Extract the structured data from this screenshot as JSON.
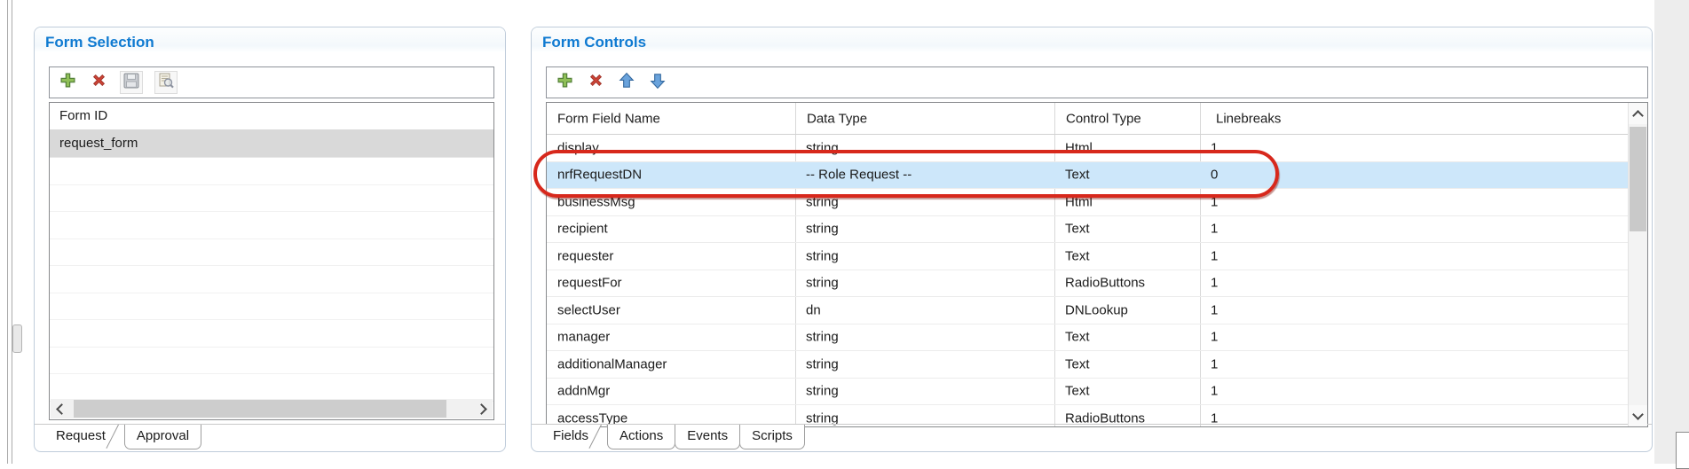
{
  "colors": {
    "title_blue": "#0f7ad1",
    "selected_row_blue": "#cde7fa",
    "selected_item_gray": "#d9d9d9",
    "annotation_red": "#d7281c",
    "toolbar_add_green": "#7ab648",
    "toolbar_delete_red": "#cc4437",
    "toolbar_arrow_blue": "#6aa3dc"
  },
  "left_panel": {
    "title": "Form Selection",
    "toolbar": [
      {
        "icon": "add-plus-icon",
        "enabled": true
      },
      {
        "icon": "delete-x-icon",
        "enabled": true
      },
      {
        "icon": "save-floppy-icon",
        "enabled": false
      },
      {
        "icon": "preview-magnifier-icon",
        "enabled": false
      }
    ],
    "list": {
      "header": "Form ID",
      "items": [
        {
          "label": "request_form",
          "selected": true
        }
      ]
    },
    "tabs": [
      {
        "label": "Request",
        "selected": true
      },
      {
        "label": "Approval",
        "selected": false
      }
    ]
  },
  "right_panel": {
    "title": "Form Controls",
    "toolbar": [
      {
        "icon": "add-plus-icon",
        "enabled": true
      },
      {
        "icon": "delete-x-icon",
        "enabled": true
      },
      {
        "icon": "move-up-arrow-icon",
        "enabled": true
      },
      {
        "icon": "move-down-arrow-icon",
        "enabled": true
      }
    ],
    "table": {
      "columns": [
        "Form Field Name",
        "Data Type",
        "Control Type",
        "Linebreaks"
      ],
      "rows": [
        {
          "cells": [
            "display",
            "string",
            "Html",
            "1"
          ],
          "selected": false
        },
        {
          "cells": [
            "nrfRequestDN",
            "-- Role Request --",
            "Text",
            "0"
          ],
          "selected": true,
          "annotated": true
        },
        {
          "cells": [
            "businessMsg",
            "string",
            "Html",
            "1"
          ],
          "selected": false
        },
        {
          "cells": [
            "recipient",
            "string",
            "Text",
            "1"
          ],
          "selected": false
        },
        {
          "cells": [
            "requester",
            "string",
            "Text",
            "1"
          ],
          "selected": false
        },
        {
          "cells": [
            "requestFor",
            "string",
            "RadioButtons",
            "1"
          ],
          "selected": false
        },
        {
          "cells": [
            "selectUser",
            "dn",
            "DNLookup",
            "1"
          ],
          "selected": false
        },
        {
          "cells": [
            "manager",
            "string",
            "Text",
            "1"
          ],
          "selected": false
        },
        {
          "cells": [
            "additionalManager",
            "string",
            "Text",
            "1"
          ],
          "selected": false
        },
        {
          "cells": [
            "addnMgr",
            "string",
            "Text",
            "1"
          ],
          "selected": false
        },
        {
          "cells": [
            "accessType",
            "string",
            "RadioButtons",
            "1"
          ],
          "selected": false
        }
      ]
    },
    "tabs": [
      {
        "label": "Fields",
        "selected": true
      },
      {
        "label": "Actions",
        "selected": false
      },
      {
        "label": "Events",
        "selected": false
      },
      {
        "label": "Scripts",
        "selected": false
      }
    ],
    "annotation": {
      "shape": "red-oval",
      "highlights_row": "nrfRequestDN"
    }
  }
}
